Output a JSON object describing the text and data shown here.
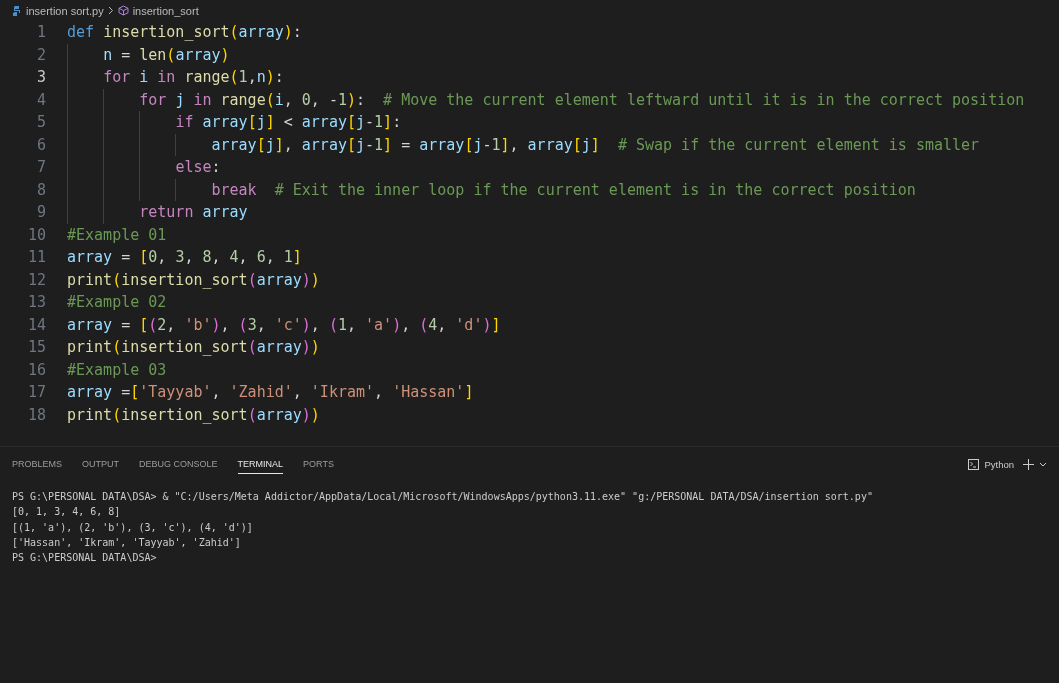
{
  "breadcrumb": {
    "file": "insertion sort.py",
    "symbol": "insertion_sort"
  },
  "editor": {
    "lines": [
      {
        "number": "1",
        "active": false,
        "tokens": [
          {
            "kind": "def",
            "text": "def "
          },
          {
            "kind": "fn",
            "text": "insertion_sort"
          },
          {
            "kind": "brk1",
            "text": "("
          },
          {
            "kind": "var",
            "text": "array"
          },
          {
            "kind": "brk1",
            "text": ")"
          },
          {
            "kind": "plain",
            "text": ":"
          }
        ]
      },
      {
        "number": "2",
        "active": false,
        "tokens": [
          {
            "kind": "var",
            "text": "    n"
          },
          {
            "kind": "plain",
            "text": " = "
          },
          {
            "kind": "fn",
            "text": "len"
          },
          {
            "kind": "brk1",
            "text": "("
          },
          {
            "kind": "var",
            "text": "array"
          },
          {
            "kind": "brk1",
            "text": ")"
          }
        ]
      },
      {
        "number": "3",
        "active": true,
        "tokens": [
          {
            "kind": "kw",
            "text": "    for "
          },
          {
            "kind": "var",
            "text": "i "
          },
          {
            "kind": "kw",
            "text": "in "
          },
          {
            "kind": "fn",
            "text": "range"
          },
          {
            "kind": "brk1",
            "text": "("
          },
          {
            "kind": "num",
            "text": "1"
          },
          {
            "kind": "plain",
            "text": ","
          },
          {
            "kind": "var",
            "text": "n"
          },
          {
            "kind": "brk1",
            "text": ")"
          },
          {
            "kind": "plain",
            "text": ":"
          }
        ]
      },
      {
        "number": "4",
        "active": false,
        "tokens": [
          {
            "kind": "kw",
            "text": "        for "
          },
          {
            "kind": "var",
            "text": "j "
          },
          {
            "kind": "kw",
            "text": "in "
          },
          {
            "kind": "fn",
            "text": "range"
          },
          {
            "kind": "brk1",
            "text": "("
          },
          {
            "kind": "var",
            "text": "i"
          },
          {
            "kind": "plain",
            "text": ", "
          },
          {
            "kind": "num",
            "text": "0"
          },
          {
            "kind": "plain",
            "text": ", -"
          },
          {
            "kind": "num",
            "text": "1"
          },
          {
            "kind": "brk1",
            "text": ")"
          },
          {
            "kind": "plain",
            "text": ":  "
          },
          {
            "kind": "comment",
            "text": "# Move the current element leftward until it is in the correct position"
          }
        ]
      },
      {
        "number": "5",
        "active": false,
        "tokens": [
          {
            "kind": "kw",
            "text": "            if "
          },
          {
            "kind": "var",
            "text": "array"
          },
          {
            "kind": "brk1",
            "text": "["
          },
          {
            "kind": "var",
            "text": "j"
          },
          {
            "kind": "brk1",
            "text": "]"
          },
          {
            "kind": "plain",
            "text": " < "
          },
          {
            "kind": "var",
            "text": "array"
          },
          {
            "kind": "brk1",
            "text": "["
          },
          {
            "kind": "var",
            "text": "j"
          },
          {
            "kind": "plain",
            "text": "-"
          },
          {
            "kind": "num",
            "text": "1"
          },
          {
            "kind": "brk1",
            "text": "]"
          },
          {
            "kind": "plain",
            "text": ":"
          }
        ]
      },
      {
        "number": "6",
        "active": false,
        "tokens": [
          {
            "kind": "var",
            "text": "                array"
          },
          {
            "kind": "brk1",
            "text": "["
          },
          {
            "kind": "var",
            "text": "j"
          },
          {
            "kind": "brk1",
            "text": "]"
          },
          {
            "kind": "plain",
            "text": ", "
          },
          {
            "kind": "var",
            "text": "array"
          },
          {
            "kind": "brk1",
            "text": "["
          },
          {
            "kind": "var",
            "text": "j"
          },
          {
            "kind": "plain",
            "text": "-"
          },
          {
            "kind": "num",
            "text": "1"
          },
          {
            "kind": "brk1",
            "text": "]"
          },
          {
            "kind": "plain",
            "text": " = "
          },
          {
            "kind": "var",
            "text": "array"
          },
          {
            "kind": "brk1",
            "text": "["
          },
          {
            "kind": "var",
            "text": "j"
          },
          {
            "kind": "plain",
            "text": "-"
          },
          {
            "kind": "num",
            "text": "1"
          },
          {
            "kind": "brk1",
            "text": "]"
          },
          {
            "kind": "plain",
            "text": ", "
          },
          {
            "kind": "var",
            "text": "array"
          },
          {
            "kind": "brk1",
            "text": "["
          },
          {
            "kind": "var",
            "text": "j"
          },
          {
            "kind": "brk1",
            "text": "]"
          },
          {
            "kind": "comment",
            "text": "  # Swap if the current element is smaller"
          }
        ]
      },
      {
        "number": "7",
        "active": false,
        "tokens": [
          {
            "kind": "kw",
            "text": "            else"
          },
          {
            "kind": "plain",
            "text": ":"
          }
        ]
      },
      {
        "number": "8",
        "active": false,
        "tokens": [
          {
            "kind": "kw",
            "text": "                break"
          },
          {
            "kind": "comment",
            "text": "  # Exit the inner loop if the current element is in the correct position"
          }
        ]
      },
      {
        "number": "9",
        "active": false,
        "tokens": [
          {
            "kind": "kw",
            "text": "        return "
          },
          {
            "kind": "var",
            "text": "array"
          }
        ]
      },
      {
        "number": "10",
        "active": false,
        "tokens": [
          {
            "kind": "comment",
            "text": "#Example 01"
          }
        ]
      },
      {
        "number": "11",
        "active": false,
        "tokens": [
          {
            "kind": "var",
            "text": "array"
          },
          {
            "kind": "plain",
            "text": " = "
          },
          {
            "kind": "brk1",
            "text": "["
          },
          {
            "kind": "num",
            "text": "0"
          },
          {
            "kind": "plain",
            "text": ", "
          },
          {
            "kind": "num",
            "text": "3"
          },
          {
            "kind": "plain",
            "text": ", "
          },
          {
            "kind": "num",
            "text": "8"
          },
          {
            "kind": "plain",
            "text": ", "
          },
          {
            "kind": "num",
            "text": "4"
          },
          {
            "kind": "plain",
            "text": ", "
          },
          {
            "kind": "num",
            "text": "6"
          },
          {
            "kind": "plain",
            "text": ", "
          },
          {
            "kind": "num",
            "text": "1"
          },
          {
            "kind": "brk1",
            "text": "]"
          }
        ]
      },
      {
        "number": "12",
        "active": false,
        "tokens": [
          {
            "kind": "fn",
            "text": "print"
          },
          {
            "kind": "brk1",
            "text": "("
          },
          {
            "kind": "fn",
            "text": "insertion_sort"
          },
          {
            "kind": "brk2",
            "text": "("
          },
          {
            "kind": "var",
            "text": "array"
          },
          {
            "kind": "brk2",
            "text": ")"
          },
          {
            "kind": "brk1",
            "text": ")"
          }
        ]
      },
      {
        "number": "13",
        "active": false,
        "tokens": [
          {
            "kind": "comment",
            "text": "#Example 02"
          }
        ]
      },
      {
        "number": "14",
        "active": false,
        "tokens": [
          {
            "kind": "var",
            "text": "array"
          },
          {
            "kind": "plain",
            "text": " = "
          },
          {
            "kind": "brk1",
            "text": "["
          },
          {
            "kind": "brk2",
            "text": "("
          },
          {
            "kind": "num",
            "text": "2"
          },
          {
            "kind": "plain",
            "text": ", "
          },
          {
            "kind": "str",
            "text": "'b'"
          },
          {
            "kind": "brk2",
            "text": ")"
          },
          {
            "kind": "plain",
            "text": ", "
          },
          {
            "kind": "brk2",
            "text": "("
          },
          {
            "kind": "num",
            "text": "3"
          },
          {
            "kind": "plain",
            "text": ", "
          },
          {
            "kind": "str",
            "text": "'c'"
          },
          {
            "kind": "brk2",
            "text": ")"
          },
          {
            "kind": "plain",
            "text": ", "
          },
          {
            "kind": "brk2",
            "text": "("
          },
          {
            "kind": "num",
            "text": "1"
          },
          {
            "kind": "plain",
            "text": ", "
          },
          {
            "kind": "str",
            "text": "'a'"
          },
          {
            "kind": "brk2",
            "text": ")"
          },
          {
            "kind": "plain",
            "text": ", "
          },
          {
            "kind": "brk2",
            "text": "("
          },
          {
            "kind": "num",
            "text": "4"
          },
          {
            "kind": "plain",
            "text": ", "
          },
          {
            "kind": "str",
            "text": "'d'"
          },
          {
            "kind": "brk2",
            "text": ")"
          },
          {
            "kind": "brk1",
            "text": "]"
          }
        ]
      },
      {
        "number": "15",
        "active": false,
        "tokens": [
          {
            "kind": "fn",
            "text": "print"
          },
          {
            "kind": "brk1",
            "text": "("
          },
          {
            "kind": "fn",
            "text": "insertion_sort"
          },
          {
            "kind": "brk2",
            "text": "("
          },
          {
            "kind": "var",
            "text": "array"
          },
          {
            "kind": "brk2",
            "text": ")"
          },
          {
            "kind": "brk1",
            "text": ")"
          }
        ]
      },
      {
        "number": "16",
        "active": false,
        "tokens": [
          {
            "kind": "comment",
            "text": "#Example 03"
          }
        ]
      },
      {
        "number": "17",
        "active": false,
        "tokens": [
          {
            "kind": "var",
            "text": "array"
          },
          {
            "kind": "plain",
            "text": " ="
          },
          {
            "kind": "brk1",
            "text": "["
          },
          {
            "kind": "str",
            "text": "'Tayyab'"
          },
          {
            "kind": "plain",
            "text": ", "
          },
          {
            "kind": "str",
            "text": "'Zahid'"
          },
          {
            "kind": "plain",
            "text": ", "
          },
          {
            "kind": "str",
            "text": "'Ikram'"
          },
          {
            "kind": "plain",
            "text": ", "
          },
          {
            "kind": "str",
            "text": "'Hassan'"
          },
          {
            "kind": "brk1",
            "text": "]"
          }
        ]
      },
      {
        "number": "18",
        "active": false,
        "tokens": [
          {
            "kind": "fn",
            "text": "print"
          },
          {
            "kind": "brk1",
            "text": "("
          },
          {
            "kind": "fn",
            "text": "insertion_sort"
          },
          {
            "kind": "brk2",
            "text": "("
          },
          {
            "kind": "var",
            "text": "array"
          },
          {
            "kind": "brk2",
            "text": ")"
          },
          {
            "kind": "brk1",
            "text": ")"
          }
        ]
      }
    ]
  },
  "panel": {
    "tabs": [
      {
        "label": "PROBLEMS",
        "selected": false
      },
      {
        "label": "OUTPUT",
        "selected": false
      },
      {
        "label": "DEBUG CONSOLE",
        "selected": false
      },
      {
        "label": "TERMINAL",
        "selected": true
      },
      {
        "label": "PORTS",
        "selected": false
      }
    ],
    "terminal_name": "Python",
    "terminal_lines": [
      "PS G:\\PERSONAL DATA\\DSA> & \"C:/Users/Meta Addictor/AppData/Local/Microsoft/WindowsApps/python3.11.exe\" \"g:/PERSONAL DATA/DSA/insertion sort.py\"",
      "[0, 1, 3, 4, 6, 8]",
      "[(1, 'a'), (2, 'b'), (3, 'c'), (4, 'd')]",
      "['Hassan', 'Ikram', 'Tayyab', 'Zahid']",
      "PS G:\\PERSONAL DATA\\DSA>"
    ]
  }
}
